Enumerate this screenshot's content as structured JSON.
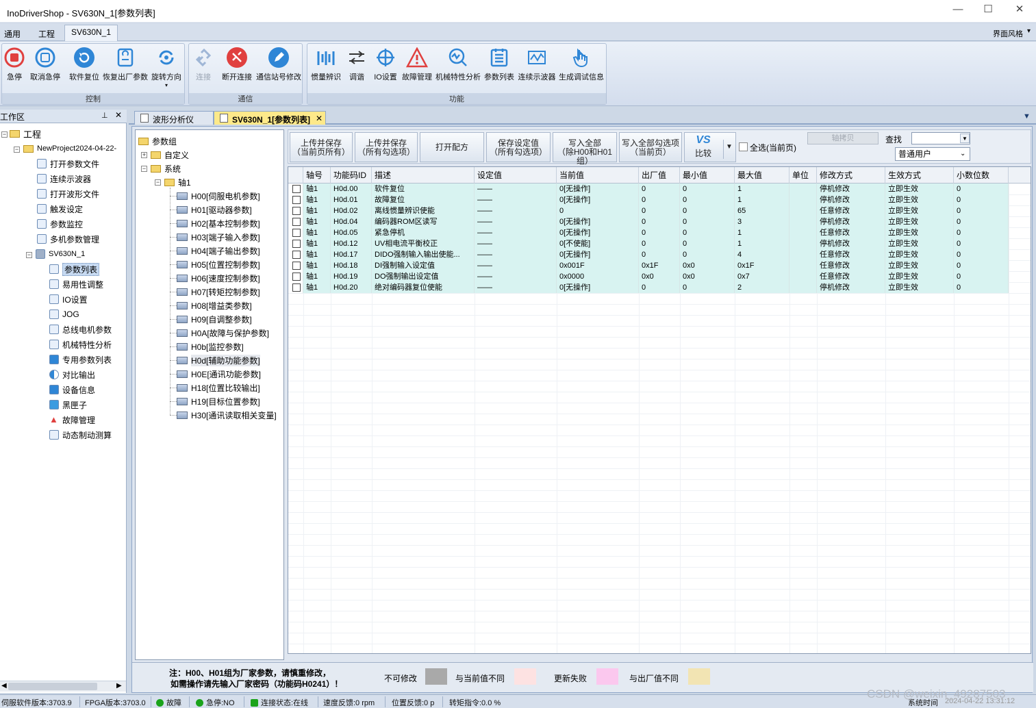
{
  "window": {
    "title": "InoDriverShop - SV630N_1[参数列表]",
    "min": "—",
    "max": "☐",
    "close": "✕"
  },
  "ribbon_tabs": [
    "通用",
    "工程",
    "SV630N_1"
  ],
  "ribbon_right": "界面风格",
  "groups": {
    "control": {
      "caption": "控制",
      "buttons": [
        "急停",
        "取消急停",
        "软件复位",
        "恢复出厂参数",
        "旋转方向"
      ]
    },
    "comm": {
      "caption": "通信",
      "buttons": [
        "连接",
        "断开连接",
        "通信站号修改"
      ]
    },
    "func": {
      "caption": "功能",
      "buttons": [
        "惯量辨识",
        "调谐",
        "IO设置",
        "故障管理",
        "机械特性分析",
        "参数列表",
        "连续示波器",
        "生成调试信息"
      ]
    }
  },
  "workspace": {
    "title": "工作区",
    "pin": "📌",
    "close": "✕",
    "items": [
      "工程",
      "NewProject2024-04-22-",
      "打开参数文件",
      "连续示波器",
      "打开波形文件",
      "触发设定",
      "参数监控",
      "多机参数管理",
      "SV630N_1",
      "参数列表",
      "易用性调整",
      "IO设置",
      "JOG",
      "总线电机参数",
      "机械特性分析",
      "专用参数列表",
      "对比输出",
      "设备信息",
      "黑匣子",
      "故障管理",
      "动态制动测算"
    ]
  },
  "doc_tabs": [
    "波形分析仪",
    "SV630N_1[参数列表]"
  ],
  "param_tree": {
    "root": "参数组",
    "custom": "自定义",
    "system": "系统",
    "axis": "轴1",
    "groups": [
      "H00[伺服电机参数]",
      "H01[驱动器参数]",
      "H02[基本控制参数]",
      "H03[端子输入参数]",
      "H04[端子输出参数]",
      "H05[位置控制参数]",
      "H06[速度控制参数]",
      "H07[转矩控制参数]",
      "H08[增益类参数]",
      "H09[自调整参数]",
      "H0A[故障与保护参数]",
      "H0b[监控参数]",
      "H0d[辅助功能参数]",
      "H0E[通讯功能参数]",
      "H18[位置比较输出]",
      "H19[目标位置参数]",
      "H30[通讯读取相关变量]"
    ]
  },
  "toolbar": {
    "btn1": [
      "上传并保存",
      "（当前页所有）"
    ],
    "btn2": [
      "上传并保存",
      "（所有勾选项）"
    ],
    "btn3": "打开配方",
    "btn4": [
      "保存设定值",
      "（所有勾选项）"
    ],
    "btn5": [
      "写入全部",
      "（除H00和H01组）"
    ],
    "btn6": [
      "写入全部勾选项",
      "（当前页）"
    ],
    "compare": "比较",
    "vs": "VS",
    "select_all": "全选(当前页)",
    "axis_copy": "轴拷贝",
    "search_label": "查找",
    "search_value": "",
    "user_value": "普通用户"
  },
  "table": {
    "headers": [
      "轴号",
      "功能码ID",
      "描述",
      "设定值",
      "当前值",
      "出厂值",
      "最小值",
      "最大值",
      "单位",
      "修改方式",
      "生效方式",
      "小数位数"
    ],
    "rows": [
      [
        "轴1",
        "H0d.00",
        "软件复位",
        "——",
        "0[无操作]",
        "0",
        "0",
        "1",
        "",
        "停机修改",
        "立即生效",
        "0"
      ],
      [
        "轴1",
        "H0d.01",
        "故障复位",
        "——",
        "0[无操作]",
        "0",
        "0",
        "1",
        "",
        "停机修改",
        "立即生效",
        "0"
      ],
      [
        "轴1",
        "H0d.02",
        "离线惯量辨识使能",
        "——",
        "0",
        "0",
        "0",
        "65",
        "",
        "任意修改",
        "立即生效",
        "0"
      ],
      [
        "轴1",
        "H0d.04",
        "编码器ROM区读写",
        "——",
        "0[无操作]",
        "0",
        "0",
        "3",
        "",
        "停机修改",
        "立即生效",
        "0"
      ],
      [
        "轴1",
        "H0d.05",
        "紧急停机",
        "——",
        "0[无操作]",
        "0",
        "0",
        "1",
        "",
        "任意修改",
        "立即生效",
        "0"
      ],
      [
        "轴1",
        "H0d.12",
        "UV相电流平衡校正",
        "——",
        "0[不使能]",
        "0",
        "0",
        "1",
        "",
        "停机修改",
        "立即生效",
        "0"
      ],
      [
        "轴1",
        "H0d.17",
        "DIDO强制输入输出使能...",
        "——",
        "0[无操作]",
        "0",
        "0",
        "4",
        "",
        "任意修改",
        "立即生效",
        "0"
      ],
      [
        "轴1",
        "H0d.18",
        "DI强制输入设定值",
        "——",
        "0x001F",
        "0x1F",
        "0x0",
        "0x1F",
        "",
        "任意修改",
        "立即生效",
        "0"
      ],
      [
        "轴1",
        "H0d.19",
        "DO强制输出设定值",
        "——",
        "0x0000",
        "0x0",
        "0x0",
        "0x7",
        "",
        "任意修改",
        "立即生效",
        "0"
      ],
      [
        "轴1",
        "H0d.20",
        "绝对编码器复位使能",
        "——",
        "0[无操作]",
        "0",
        "0",
        "2",
        "",
        "停机修改",
        "立即生效",
        "0"
      ]
    ]
  },
  "legend": {
    "note1": "注：H00、H01组为厂家参数，请慎重修改，",
    "note2": "如需操作请先输入厂家密码（功能码H0241）！",
    "items": [
      {
        "label": "不可修改",
        "color": "#a9a9a9"
      },
      {
        "label": "与当前值不同",
        "color": "#fde2e2"
      },
      {
        "label": "更新失败",
        "color": "#fbc8ee"
      },
      {
        "label": "与出厂值不同",
        "color": "#f2e4b3"
      }
    ]
  },
  "status": {
    "sw": "伺服软件版本:3703.9",
    "fpga": "FPGA版本:3703.0",
    "fault": "故障",
    "estop": "急停:NO",
    "conn": "连接状态:在线",
    "speed": "速度反馈:0 rpm",
    "pos": "位置反馈:0 p",
    "torque": "转矩指令:0.0 %",
    "systime_label": "系统时间",
    "systime": "2024-04-22 13:31:12",
    "watermark": "CSDN @weixin_49287503"
  },
  "colors": {
    "row_bg": "#d8f3f1",
    "accent": "#2f86d6",
    "stop_red": "#e0403f"
  }
}
